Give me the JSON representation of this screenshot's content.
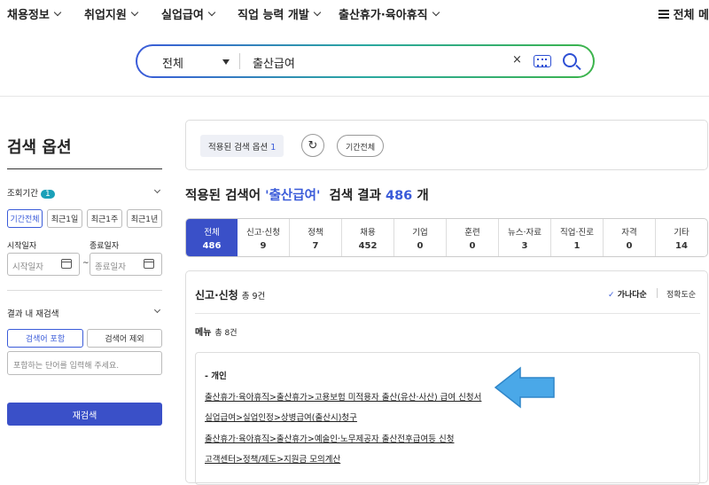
{
  "nav": {
    "items": [
      "채용정보",
      "취업지원",
      "실업급여",
      "직업 능력 개발",
      "출산휴가·육아휴직"
    ],
    "all_menu": "전체 메"
  },
  "search": {
    "scope": "전체",
    "query": "출산급여",
    "clear_glyph": "×"
  },
  "sidebar": {
    "title": "검색 옵션",
    "period_label": "조회기간",
    "period_badge": "1",
    "period_buttons": [
      "기간전체",
      "최근1일",
      "최근1주",
      "최근1년"
    ],
    "start_label": "시작일자",
    "end_label": "종료일자",
    "start_placeholder": "시작일자",
    "end_placeholder": "종료일자",
    "tilde": "~",
    "research_label": "결과 내 재검색",
    "include_btn": "검색어 포함",
    "exclude_btn": "검색어 제외",
    "keyword_placeholder": "포함하는 단어를 입력해 주세요.",
    "research_btn": "재검색"
  },
  "applied": {
    "chip_text": "적용된 검색 옵션",
    "chip_count": "1",
    "refresh_glyph": "↻",
    "period_chip": "기간전체"
  },
  "result": {
    "prefix": "적용된 검색어",
    "keyword": "'출산급여'",
    "middle": "검색 결과",
    "count": "486",
    "suffix": "개"
  },
  "tabs": [
    {
      "label": "전체",
      "count": "486"
    },
    {
      "label": "신고·신청",
      "count": "9"
    },
    {
      "label": "정책",
      "count": "7"
    },
    {
      "label": "채용",
      "count": "452"
    },
    {
      "label": "기업",
      "count": "0"
    },
    {
      "label": "훈련",
      "count": "0"
    },
    {
      "label": "뉴스·자료",
      "count": "3"
    },
    {
      "label": "직업·진로",
      "count": "1"
    },
    {
      "label": "자격",
      "count": "0"
    },
    {
      "label": "기타",
      "count": "14"
    }
  ],
  "section": {
    "title": "신고·신청",
    "total": "총 9건",
    "sort_check": "✓",
    "sort_active": "가나다순",
    "sort_other": "정확도순",
    "menu_title": "메뉴",
    "menu_total": "총 8건",
    "group": "- 개인",
    "links": [
      "출산휴가·육아휴직>출산휴가>고용보험 미적용자 출산(유산·사산) 급여 신청서",
      "실업급여>실업인정>상병급여(출산시)청구",
      "출산휴가·육아휴직>출산휴가>예술인·노무제공자 출산전후급여등 신청",
      "고객센터>정책/제도>지원금 모의계산"
    ]
  },
  "colors": {
    "accent": "#3a50c8",
    "badge": "#1aa0b8",
    "arrow": "#4aa8e8"
  }
}
